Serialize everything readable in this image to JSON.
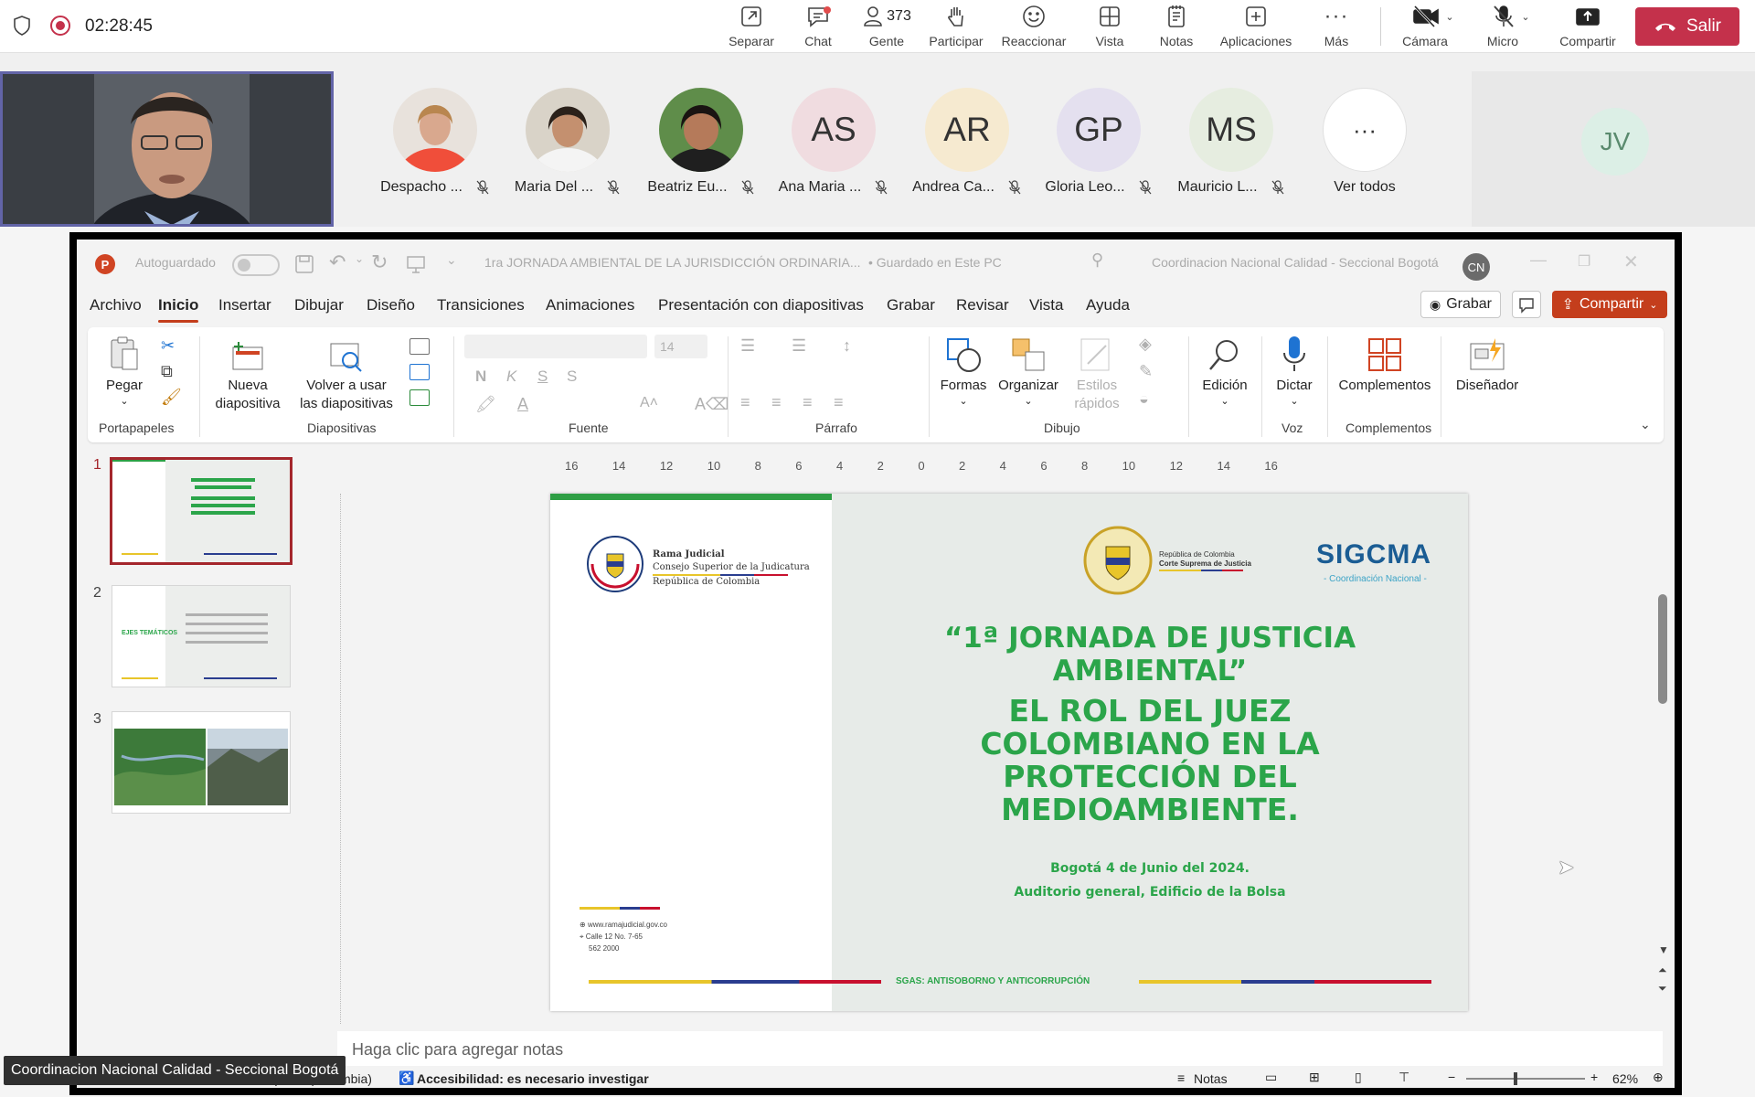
{
  "meeting": {
    "timer": "02:28:45",
    "people_count": "373",
    "toolbar": [
      {
        "label": "Separar",
        "icon": "pop-out-icon"
      },
      {
        "label": "Chat",
        "icon": "chat-icon"
      },
      {
        "label": "Gente",
        "icon": "people-icon"
      },
      {
        "label": "Participar",
        "icon": "raise-hand-icon"
      },
      {
        "label": "Reaccionar",
        "icon": "react-icon"
      },
      {
        "label": "Vista",
        "icon": "view-icon"
      },
      {
        "label": "Notas",
        "icon": "notes-icon"
      },
      {
        "label": "Aplicaciones",
        "icon": "apps-icon"
      },
      {
        "label": "Más",
        "icon": "more-icon"
      },
      {
        "label": "Cámara",
        "icon": "camera-off-icon"
      },
      {
        "label": "Micro",
        "icon": "mic-off-icon"
      },
      {
        "label": "Compartir",
        "icon": "share-icon"
      }
    ],
    "leave_label": "Salir",
    "participants": [
      {
        "name": "Despacho ...",
        "initials": "",
        "color": "#f26b4e"
      },
      {
        "name": "Maria Del ...",
        "initials": "",
        "color": "#ddd6c8"
      },
      {
        "name": "Beatriz Eu...",
        "initials": "",
        "color": "#5c8a45"
      },
      {
        "name": "Ana Maria ...",
        "initials": "AS",
        "color": "#f0dce0"
      },
      {
        "name": "Andrea Ca...",
        "initials": "AR",
        "color": "#f6ead0"
      },
      {
        "name": "Gloria Leo...",
        "initials": "GP",
        "color": "#e4e0ef"
      },
      {
        "name": "Mauricio L...",
        "initials": "MS",
        "color": "#e6ede0"
      }
    ],
    "see_all_label": "Ver todos",
    "jv_initials": "JV",
    "caption": "Coordinacion Nacional Calidad - Seccional Bogotá"
  },
  "ppt": {
    "autosave_label": "Autoguardado",
    "doc_title": "1ra JORNADA AMBIENTAL DE LA JURISDICCIÓN ORDINARIA...",
    "save_status": "• Guardado en Este PC",
    "account": "Coordinacion Nacional Calidad - Seccional Bogotá",
    "account_initials": "CN",
    "tabs": [
      "Archivo",
      "Inicio",
      "Insertar",
      "Dibujar",
      "Diseño",
      "Transiciones",
      "Animaciones",
      "Presentación con diapositivas",
      "Grabar",
      "Revisar",
      "Vista",
      "Ayuda"
    ],
    "grabar_label": "Grabar",
    "compartir_label": "Compartir",
    "ribbon": {
      "pegar": "Pegar",
      "nueva": "Nueva diapositiva",
      "volver": "Volver a usar las diapositivas",
      "font_size": "14",
      "bold": "N",
      "italic": "K",
      "underline": "S",
      "strike": "S",
      "formas": "Formas",
      "organizar": "Organizar",
      "estilos": "Estilos rápidos",
      "edicion": "Edición",
      "dictar": "Dictar",
      "complementos": "Complementos",
      "disenador": "Diseñador",
      "groups": [
        "Portapapeles",
        "Diapositivas",
        "Fuente",
        "Párrafo",
        "Dibujo",
        "Voz",
        "Complementos"
      ]
    },
    "ruler_ticks": [
      "16",
      "14",
      "12",
      "10",
      "8",
      "6",
      "4",
      "2",
      "0",
      "2",
      "4",
      "6",
      "8",
      "10",
      "12",
      "14",
      "16"
    ],
    "slide_numbers": [
      "1",
      "2",
      "3"
    ],
    "thumb2_label": "EJES TEMÁTICOS",
    "slide": {
      "org_line1": "Rama Judicial",
      "org_line2": "Consejo Superior de la Judicatura",
      "org_line3": "República de Colombia",
      "court_line1": "República de Colombia",
      "court_line2": "Corte Suprema de Justicia",
      "brand": "SIGCMA",
      "brand_sub": "- Coordinación Nacional -",
      "title1": "“1ª JORNADA DE JUSTICIA",
      "title2": "AMBIENTAL”",
      "title3": "EL ROL DEL JUEZ",
      "title4": "COLOMBIANO EN LA",
      "title5": "PROTECCIÓN DEL",
      "title6": "MEDIOAMBIENTE.",
      "date": "Bogotá 4 de Junio del 2024.",
      "venue": "Auditorio general, Edificio de la Bolsa",
      "footer": "SGAS: ANTISOBORNO Y ANTICORRUPCIÓN",
      "web": "www.ramajudicial.gov.co",
      "address": "Calle 12 No. 7-65",
      "phone": "562 2000"
    },
    "notes_placeholder": "Haga clic para agregar notas",
    "status": {
      "language": "Español (Colombia)",
      "accessibility": "Accesibilidad: es necesario investigar",
      "notes": "Notas",
      "zoom": "62%"
    }
  }
}
